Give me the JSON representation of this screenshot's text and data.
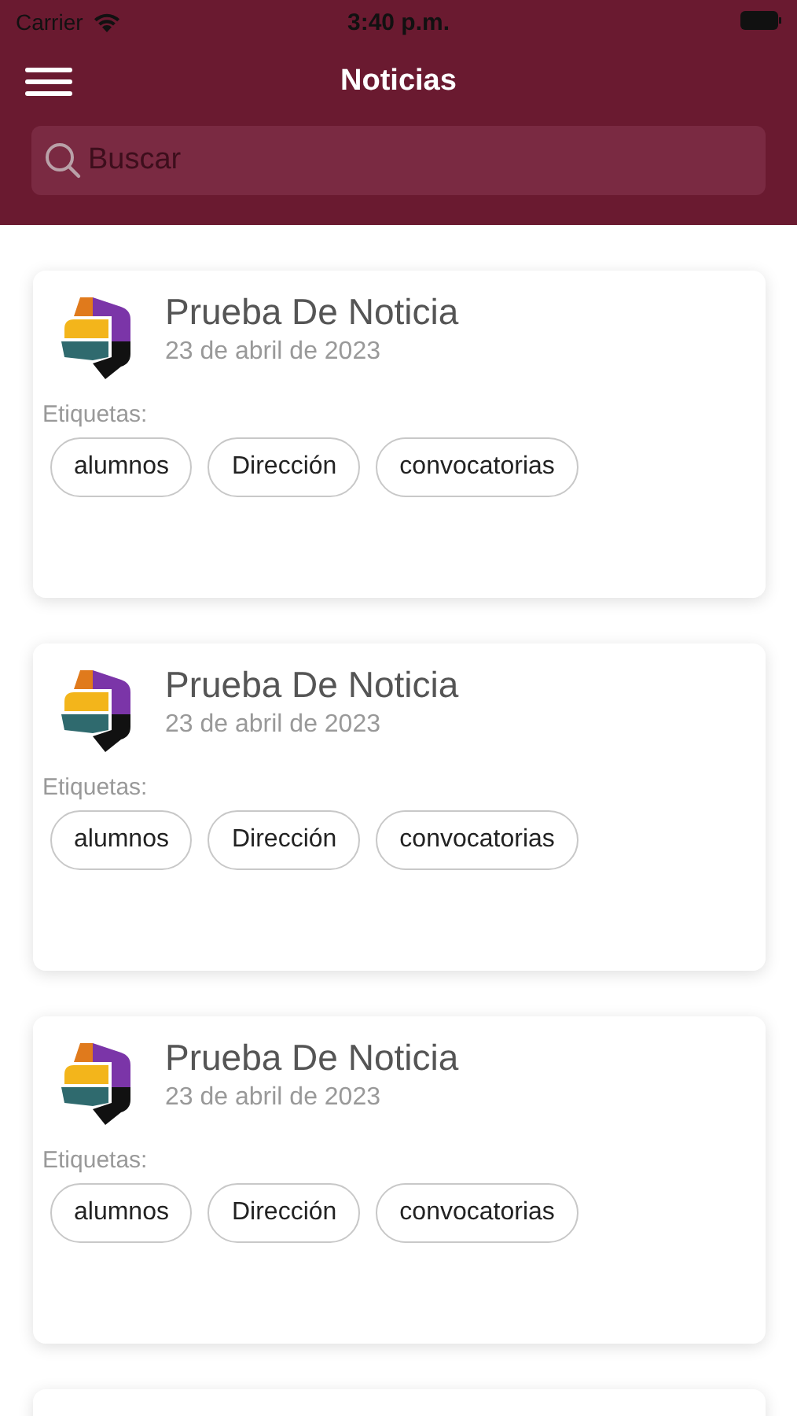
{
  "status_bar": {
    "carrier": "Carrier",
    "time": "3:40 p.m."
  },
  "nav": {
    "title": "Noticias"
  },
  "search": {
    "placeholder": "Buscar"
  },
  "news": [
    {
      "title": "Prueba De Noticia",
      "date": "23 de abril de 2023",
      "tags_label": "Etiquetas:",
      "tags": [
        "alumnos",
        "Dirección",
        "convocatorias"
      ]
    },
    {
      "title": "Prueba De Noticia",
      "date": "23 de abril de 2023",
      "tags_label": "Etiquetas:",
      "tags": [
        "alumnos",
        "Dirección",
        "convocatorias"
      ]
    },
    {
      "title": "Prueba De Noticia",
      "date": "23 de abril de 2023",
      "tags_label": "Etiquetas:",
      "tags": [
        "alumnos",
        "Dirección",
        "convocatorias"
      ]
    }
  ]
}
